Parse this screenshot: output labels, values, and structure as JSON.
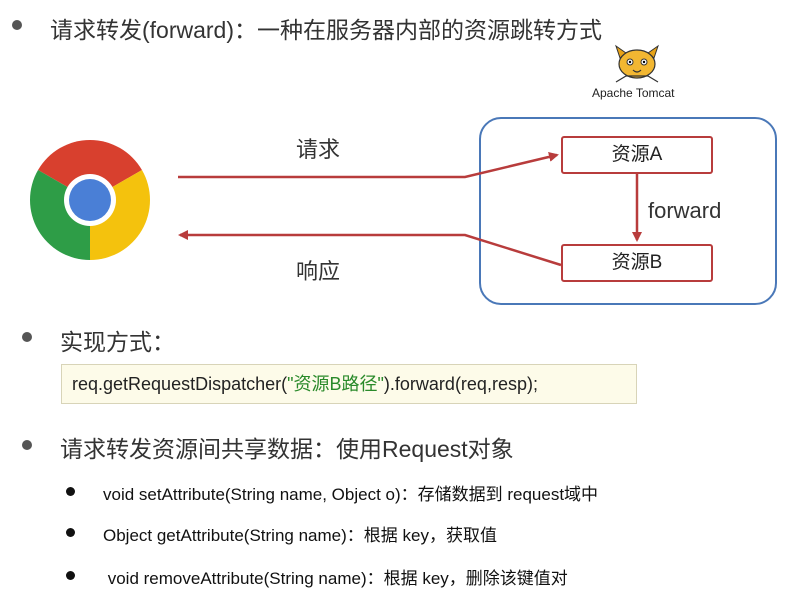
{
  "title": "请求转发(forward)：一种在服务器内部的资源跳转方式",
  "diagram": {
    "request_label": "请求",
    "response_label": "响应",
    "forward_label": "forward",
    "resource_a": "资源A",
    "resource_b": "资源B",
    "server_logo_text": "Apache Tomcat",
    "colors": {
      "arrow": "#b83c3c",
      "server_border": "#4a78b8"
    }
  },
  "impl": {
    "heading": "实现方式：",
    "code_prefix": "req.getRequestDispatcher(",
    "code_string": "\"资源B路径\"",
    "code_suffix": ").forward(req,resp);"
  },
  "share": {
    "heading": "请求转发资源间共享数据：使用Request对象",
    "items": [
      "void setAttribute(String name, Object o)：存储数据到 request域中",
      "Object getAttribute(String name)：根据 key，获取值",
      " void removeAttribute(String name)：根据 key，删除该键值对"
    ]
  }
}
